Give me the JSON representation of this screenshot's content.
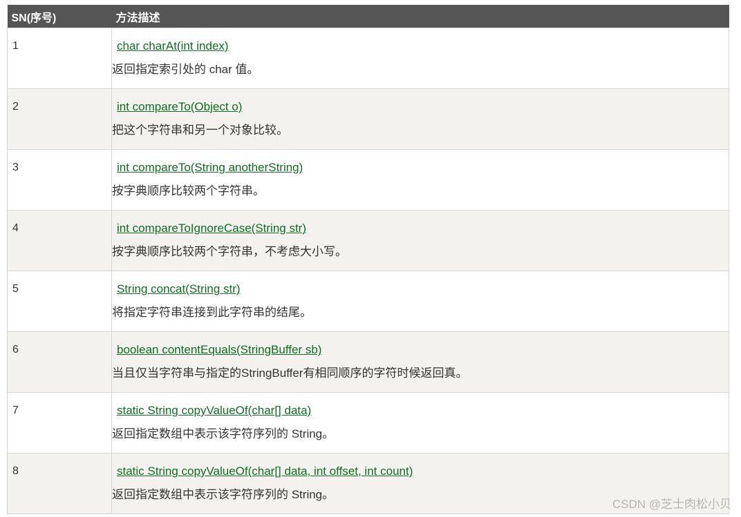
{
  "header": {
    "col_sn": "SN(序号)",
    "col_desc": "方法描述"
  },
  "rows": [
    {
      "sn": "1",
      "method": "char charAt(int index)",
      "desc": "返回指定索引处的 char 值。"
    },
    {
      "sn": "2",
      "method": "int compareTo(Object o)",
      "desc": "把这个字符串和另一个对象比较。"
    },
    {
      "sn": "3",
      "method": "int compareTo(String anotherString)",
      "desc": "按字典顺序比较两个字符串。"
    },
    {
      "sn": "4",
      "method": "int compareToIgnoreCase(String str)",
      "desc": "按字典顺序比较两个字符串，不考虑大小写。"
    },
    {
      "sn": "5",
      "method": "String concat(String str)",
      "desc": "将指定字符串连接到此字符串的结尾。"
    },
    {
      "sn": "6",
      "method": "boolean contentEquals(StringBuffer sb)",
      "desc": "当且仅当字符串与指定的StringBuffer有相同顺序的字符时候返回真。"
    },
    {
      "sn": "7",
      "method": "static String copyValueOf(char[] data)",
      "desc": "返回指定数组中表示该字符序列的 String。"
    },
    {
      "sn": "8",
      "method": "static String copyValueOf(char[] data, int offset, int count)",
      "desc": "返回指定数组中表示该字符序列的 String。"
    }
  ],
  "watermark": "CSDN @芝士肉松小贝",
  "colors": {
    "header_bg": "#555555",
    "link": "#0f6d22",
    "alt_row": "#f3f2ee"
  }
}
